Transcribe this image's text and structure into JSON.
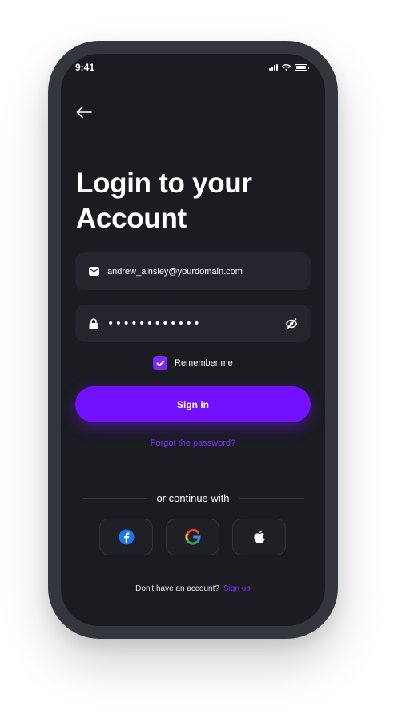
{
  "status_bar": {
    "time": "9:41"
  },
  "header": {
    "title": "Login to your\nAccount"
  },
  "form": {
    "email_value": "andrew_ainsley@yourdomain.com",
    "password_masked": "••••••••••••",
    "remember_label": "Remember me",
    "remember_checked": true,
    "signin_label": "Sign in",
    "forgot_label": "Forgot the password?"
  },
  "social": {
    "divider_label": "or continue with",
    "providers": [
      "facebook-icon",
      "google-icon",
      "apple-icon"
    ]
  },
  "footer": {
    "question": "Don't have an account?",
    "signup_label": "Sign up"
  },
  "colors": {
    "accent": "#7210ff",
    "background": "#1b1c21",
    "field": "#25262d",
    "frame": "#34363d"
  }
}
